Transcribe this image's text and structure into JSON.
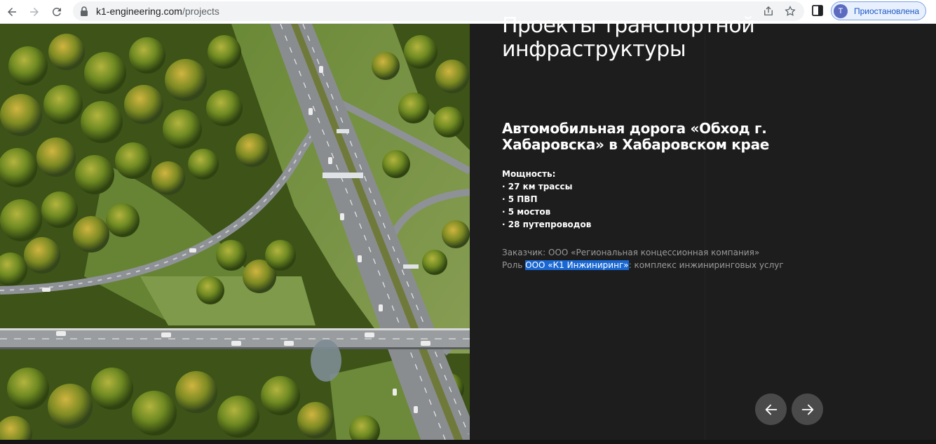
{
  "browser": {
    "url_domain": "k1-engineering.com",
    "url_path": "/projects",
    "profile_initial": "Т",
    "profile_label": "Приостановлена",
    "accent_color": "#1a56c4"
  },
  "section": {
    "title": "Проекты транспортной инфраструктуры"
  },
  "project": {
    "title": "Автомобильная дорога «Обход г. Хабаровска» в Хабаровском крае",
    "capacity_label": "Мощность:",
    "capacity_items": [
      "· 27 км трассы",
      "· 5 ПВП",
      "· 5 мостов",
      "· 28 путепроводов"
    ],
    "client": "Заказчик: ООО «Региональная концессионная компания»",
    "role_prefix": "Роль ",
    "role_company": "ООО «К1 Инжиниринг»",
    "role_suffix": ": комплекс инжиниринговых услуг"
  },
  "icons": {
    "back": "arrow-left-icon",
    "forward": "arrow-right-icon",
    "reload": "reload-icon",
    "lock": "lock-icon",
    "share": "share-icon",
    "bookmark": "star-icon",
    "side_panel": "side-panel-icon",
    "prev_slide": "arrow-left-icon",
    "next_slide": "arrow-right-icon"
  }
}
